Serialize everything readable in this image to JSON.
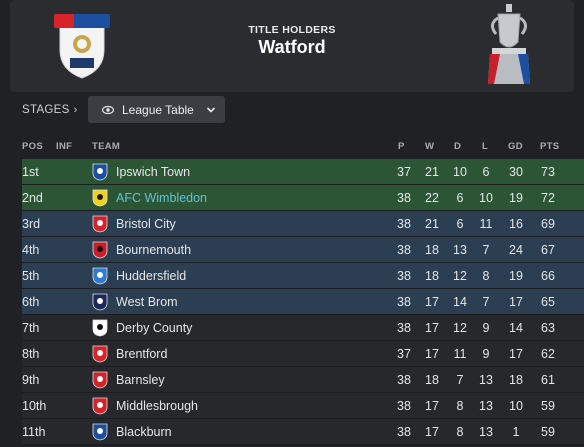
{
  "header": {
    "holders_label": "TITLE HOLDERS",
    "holders_team": "Watford",
    "logo_icon": "efl-championship-logo-icon",
    "trophy_icon": "trophy-icon"
  },
  "stages": {
    "label": "STAGES",
    "chevron_icon": "chevron-right-icon",
    "dropdown_label": "League Table",
    "dropdown_icon": "eye-icon",
    "caret_icon": "chevron-down-icon"
  },
  "columns": {
    "pos": "POS",
    "inf": "INF",
    "team": "TEAM",
    "p": "P",
    "w": "W",
    "d": "D",
    "l": "L",
    "gd": "GD",
    "pts": "PTS"
  },
  "colors": {
    "promotion_row": "#2c5535",
    "playoff_row": "#2c3e52",
    "highlight_team": "#5fc3d8"
  },
  "rows": [
    {
      "pos": "1st",
      "team": "Ipswich Town",
      "p": "37",
      "w": "21",
      "d": "10",
      "l": "6",
      "gd": "30",
      "pts": "73",
      "zone": "promo"
    },
    {
      "pos": "2nd",
      "team": "AFC Wimbledon",
      "p": "38",
      "w": "22",
      "d": "6",
      "l": "10",
      "gd": "19",
      "pts": "72",
      "zone": "promo"
    },
    {
      "pos": "3rd",
      "team": "Bristol City",
      "p": "38",
      "w": "21",
      "d": "6",
      "l": "11",
      "gd": "16",
      "pts": "69",
      "zone": "playoff"
    },
    {
      "pos": "4th",
      "team": "Bournemouth",
      "p": "38",
      "w": "18",
      "d": "13",
      "l": "7",
      "gd": "24",
      "pts": "67",
      "zone": "playoff"
    },
    {
      "pos": "5th",
      "team": "Huddersfield",
      "p": "38",
      "w": "18",
      "d": "12",
      "l": "8",
      "gd": "19",
      "pts": "66",
      "zone": "playoff"
    },
    {
      "pos": "6th",
      "team": "West Brom",
      "p": "38",
      "w": "17",
      "d": "14",
      "l": "7",
      "gd": "17",
      "pts": "65",
      "zone": "playoff"
    },
    {
      "pos": "7th",
      "team": "Derby County",
      "p": "38",
      "w": "17",
      "d": "12",
      "l": "9",
      "gd": "14",
      "pts": "63",
      "zone": "normal"
    },
    {
      "pos": "8th",
      "team": "Brentford",
      "p": "37",
      "w": "17",
      "d": "11",
      "l": "9",
      "gd": "17",
      "pts": "62",
      "zone": "normal"
    },
    {
      "pos": "9th",
      "team": "Barnsley",
      "p": "38",
      "w": "18",
      "d": "7",
      "l": "13",
      "gd": "18",
      "pts": "61",
      "zone": "normal"
    },
    {
      "pos": "10th",
      "team": "Middlesbrough",
      "p": "38",
      "w": "17",
      "d": "8",
      "l": "13",
      "gd": "10",
      "pts": "59",
      "zone": "normal"
    },
    {
      "pos": "11th",
      "team": "Blackburn",
      "p": "38",
      "w": "17",
      "d": "8",
      "l": "13",
      "gd": "1",
      "pts": "59",
      "zone": "normal"
    }
  ]
}
